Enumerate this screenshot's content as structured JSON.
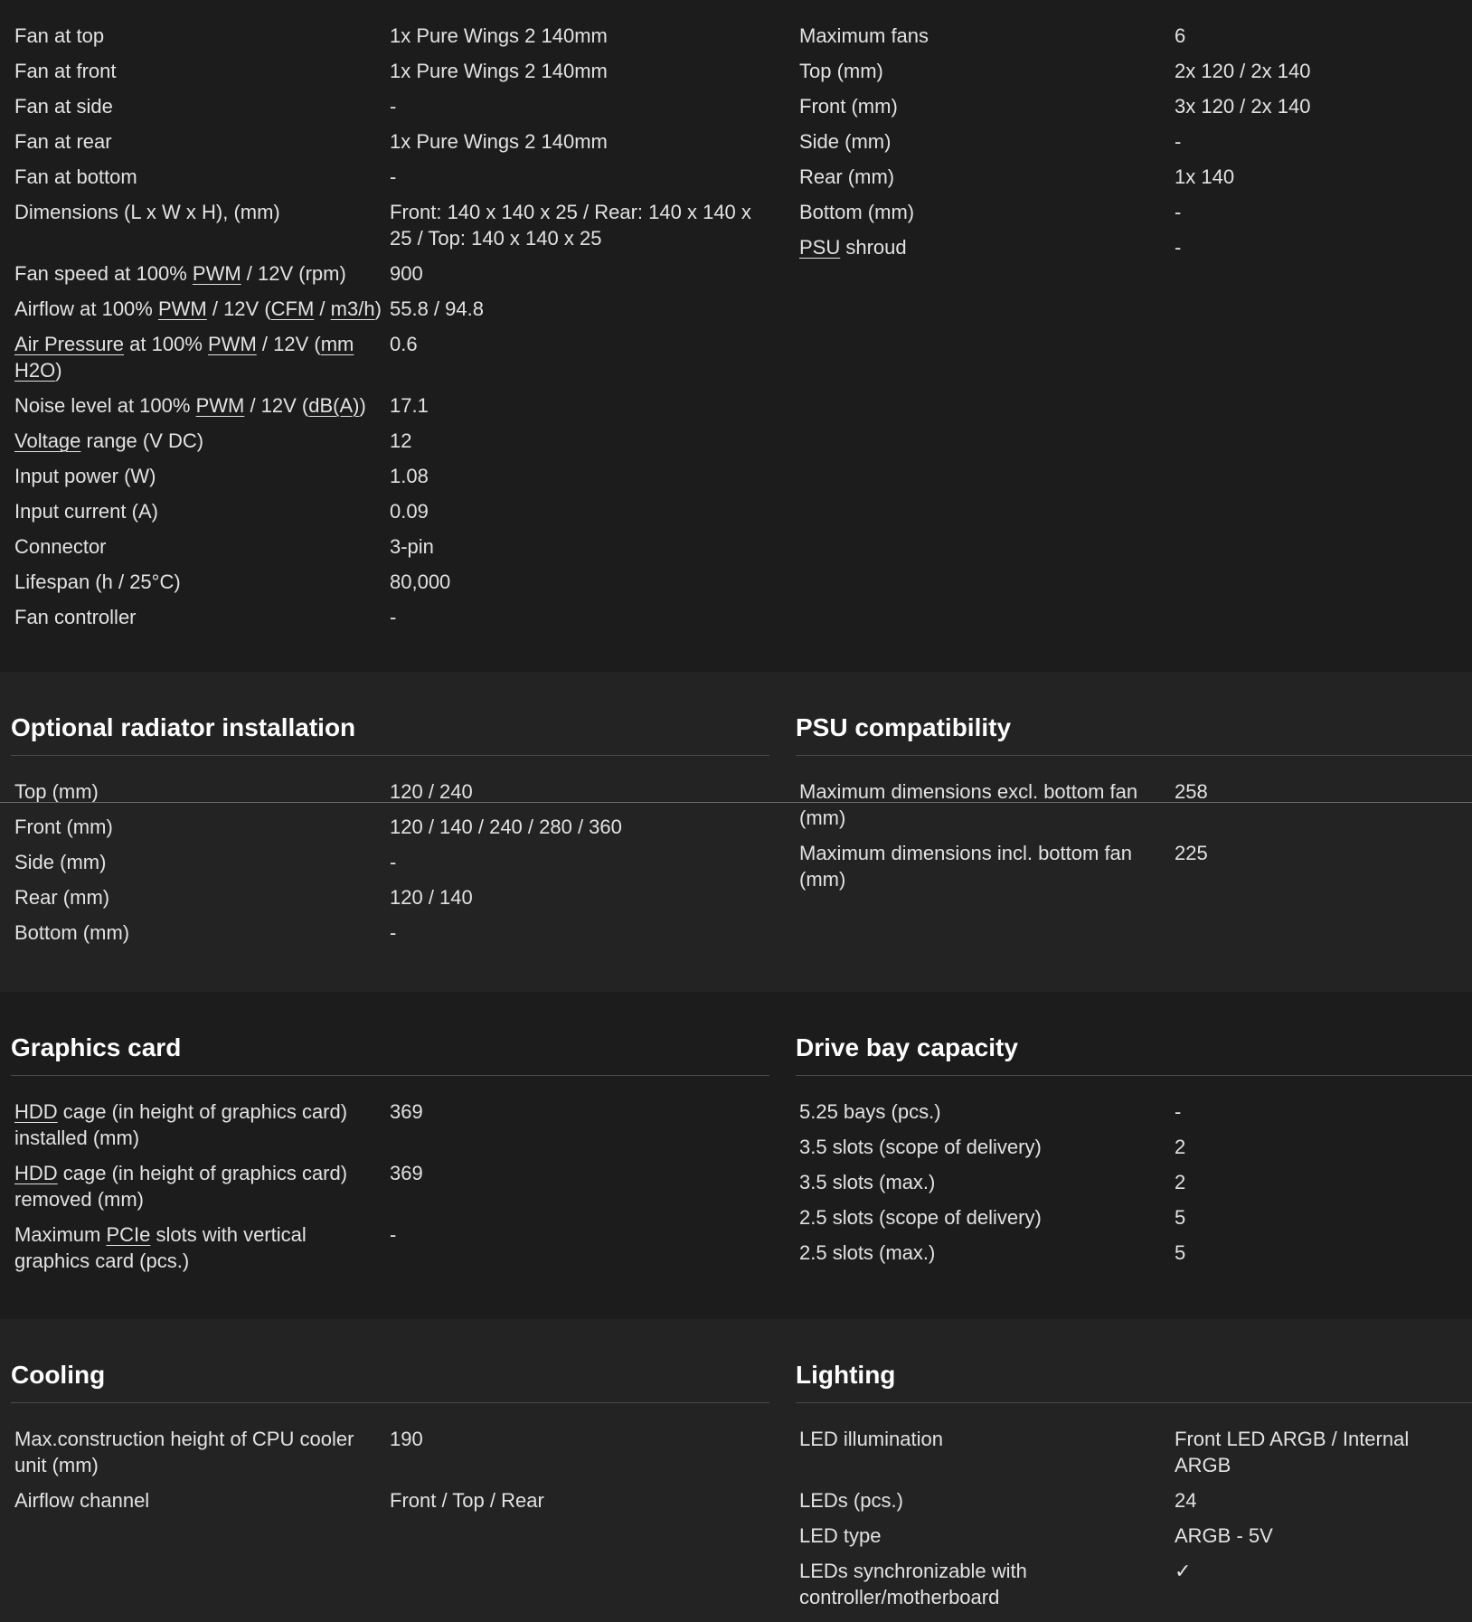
{
  "fan_config": {
    "left_rows": [
      {
        "key": "Fan at top",
        "value": "1x Pure Wings 2 140mm"
      },
      {
        "key": "Fan at front",
        "value": "1x Pure Wings 2 140mm"
      },
      {
        "key": "Fan at side",
        "value": "-"
      },
      {
        "key": "Fan at rear",
        "value": "1x Pure Wings 2 140mm"
      },
      {
        "key": "Fan at bottom",
        "value": "-"
      },
      {
        "key": "Dimensions (L x W x H), (mm)",
        "value": "Front: 140 x 140 x 25 / Rear: 140 x 140 x 25 / Top: 140 x 140 x 25"
      },
      {
        "key": "Fan speed at 100% PWM / 12V (rpm)",
        "value": "900"
      },
      {
        "key": "Airflow at 100% PWM / 12V (CFM / m3/h)",
        "value": "55.8 / 94.8"
      },
      {
        "key": "Air Pressure at 100% PWM / 12V (mm H2O)",
        "value": "0.6"
      },
      {
        "key": "Noise level at 100% PWM / 12V (dB(A))",
        "value": "17.1"
      },
      {
        "key": "Voltage range (V DC)",
        "value": "12"
      },
      {
        "key": "Input power (W)",
        "value": "1.08"
      },
      {
        "key": "Input current (A)",
        "value": "0.09"
      },
      {
        "key": "Connector",
        "value": "3-pin"
      },
      {
        "key": "Lifespan (h / 25°C)",
        "value": "80,000"
      },
      {
        "key": "Fan controller",
        "value": "-"
      }
    ],
    "right_rows": [
      {
        "key": "Maximum fans",
        "value": "6"
      },
      {
        "key": "Top (mm)",
        "value": "2x 120 / 2x 140"
      },
      {
        "key": "Front (mm)",
        "value": "3x 120 / 2x 140"
      },
      {
        "key": "Side (mm)",
        "value": "-"
      },
      {
        "key": "Rear (mm)",
        "value": "1x 140"
      },
      {
        "key": "Bottom (mm)",
        "value": "-"
      },
      {
        "key": "PSU shroud",
        "value": "-"
      }
    ]
  },
  "radiator": {
    "title": "Optional radiator installation",
    "rows": [
      {
        "key": "Top (mm)",
        "value": "120 / 240"
      },
      {
        "key": "Front (mm)",
        "value": "120 / 140 / 240 / 280 / 360"
      },
      {
        "key": "Side (mm)",
        "value": "-"
      },
      {
        "key": "Rear (mm)",
        "value": "120 / 140"
      },
      {
        "key": "Bottom (mm)",
        "value": "-"
      }
    ]
  },
  "psu": {
    "title": "PSU compatibility",
    "rows": [
      {
        "key": "Maximum dimensions excl. bottom fan (mm)",
        "value": "258"
      },
      {
        "key": "Maximum dimensions incl. bottom fan (mm)",
        "value": "225"
      }
    ]
  },
  "graphics": {
    "title": "Graphics card",
    "rows": [
      {
        "key": "HDD cage (in height of graphics card) installed (mm)",
        "value": "369"
      },
      {
        "key": "HDD cage (in height of graphics card) removed (mm)",
        "value": "369"
      },
      {
        "key": "Maximum PCIe slots with vertical graphics card (pcs.)",
        "value": "-"
      }
    ]
  },
  "drive_bay": {
    "title": "Drive bay capacity",
    "rows": [
      {
        "key": "5.25 bays (pcs.)",
        "value": "-"
      },
      {
        "key": "3.5 slots (scope of delivery)",
        "value": "2"
      },
      {
        "key": "3.5 slots (max.)",
        "value": "2"
      },
      {
        "key": "2.5 slots (scope of delivery)",
        "value": "5"
      },
      {
        "key": "2.5 slots (max.)",
        "value": "5"
      }
    ]
  },
  "cooling": {
    "title": "Cooling",
    "rows": [
      {
        "key": "Max.construction height of CPU cooler unit (mm)",
        "value": "190"
      },
      {
        "key": "Airflow channel",
        "value": "Front / Top / Rear"
      }
    ]
  },
  "lighting": {
    "title": "Lighting",
    "rows": [
      {
        "key": "LED illumination",
        "value": "Front LED ARGB / Internal ARGB"
      },
      {
        "key": "LEDs (pcs.)",
        "value": "24"
      },
      {
        "key": "LED type",
        "value": "ARGB - 5V"
      },
      {
        "key": "LEDs synchronizable with controller/motherboard",
        "value": "✓"
      }
    ]
  },
  "underlined_terms": [
    "PWM",
    "CFM",
    "m3/h",
    "Air Pressure",
    "mm H2O",
    "dB(A)",
    "Voltage",
    "PSU",
    "HDD",
    "PCIe"
  ],
  "colors": {
    "background_dark": "#1c1c1c",
    "background_alt": "#232323",
    "text": "#e2e2e2",
    "heading": "#ffffff",
    "rule": "#4a4a4a"
  }
}
